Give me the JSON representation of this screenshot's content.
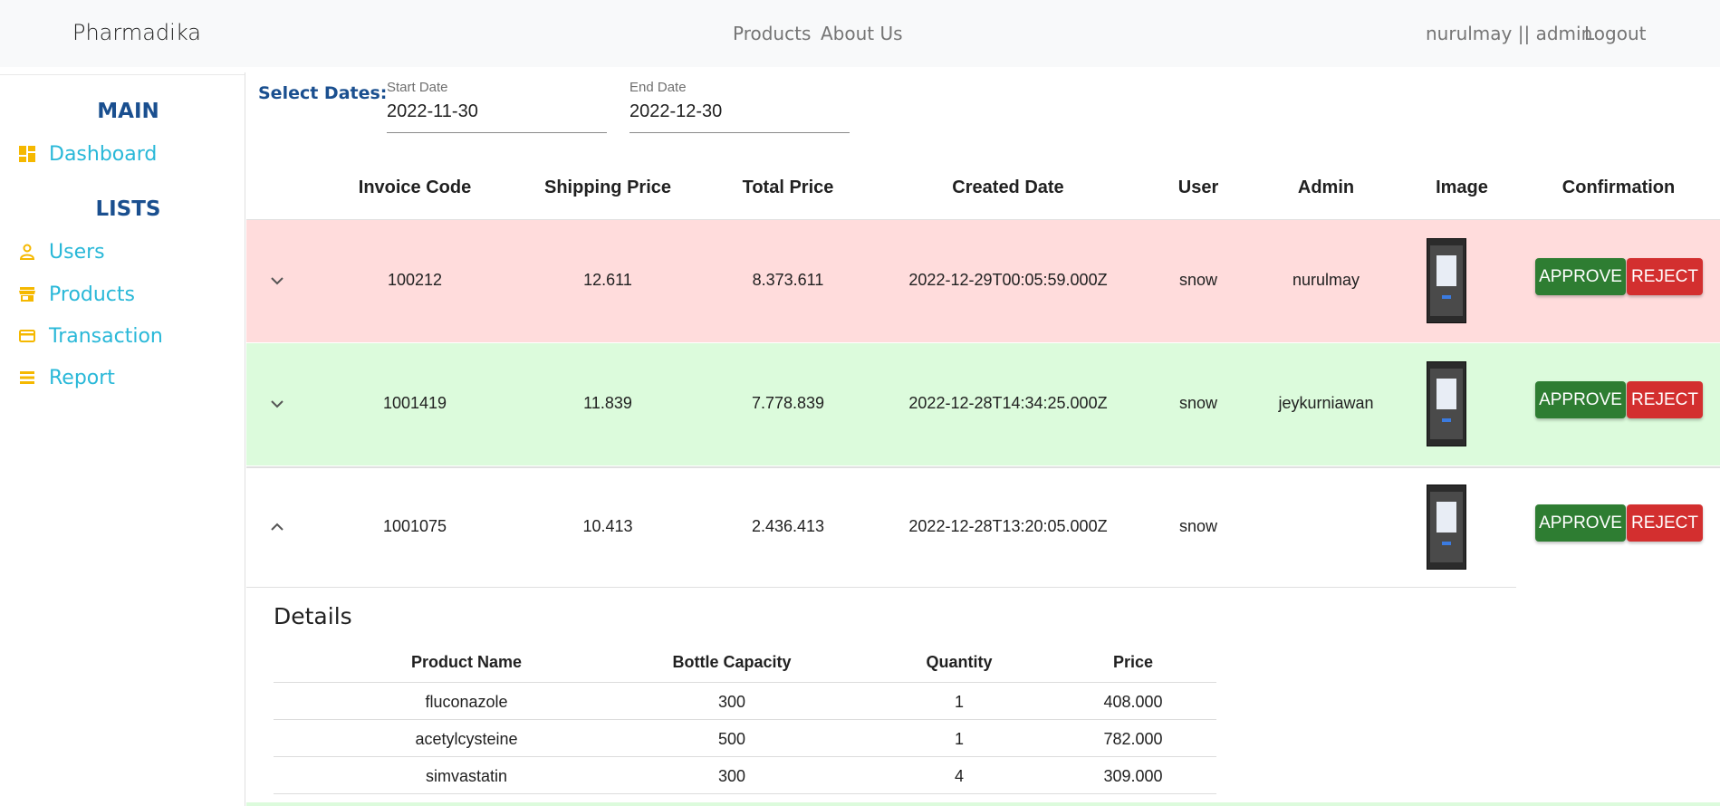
{
  "navbar": {
    "brand": "Pharmadika",
    "links": [
      "Products",
      "About Us"
    ],
    "user": "nurulmay || admin",
    "logout": "Logout"
  },
  "sidebar": {
    "main_title": "MAIN",
    "dashboard": "Dashboard",
    "lists_title": "LISTS",
    "items": [
      "Users",
      "Products",
      "Transaction",
      "Report"
    ]
  },
  "filters": {
    "select_label": "Select Dates:",
    "start_label": "Start Date",
    "start_value": "2022-11-30",
    "end_label": "End Date",
    "end_value": "2022-12-30"
  },
  "table": {
    "headers": [
      "Invoice Code",
      "Shipping Price",
      "Total Price",
      "Created Date",
      "User",
      "Admin",
      "Image",
      "Confirmation"
    ],
    "rows": [
      {
        "invoice": "100212",
        "shipping": "12.611",
        "total": "8.373.611",
        "created": "2022-12-29T00:05:59.000Z",
        "user": "snow",
        "admin": "nurulmay",
        "bg": "#ffdcdc",
        "expanded": false
      },
      {
        "invoice": "1001419",
        "shipping": "11.839",
        "total": "7.778.839",
        "created": "2022-12-28T14:34:25.000Z",
        "user": "snow",
        "admin": "jeykurniawan",
        "bg": "#dcfbdc",
        "expanded": false
      },
      {
        "invoice": "1001075",
        "shipping": "10.413",
        "total": "2.436.413",
        "created": "2022-12-28T13:20:05.000Z",
        "user": "snow",
        "admin": "",
        "bg": "#ffffff",
        "expanded": true
      }
    ],
    "approve_label": "APPROVE",
    "reject_label": "REJECT"
  },
  "details": {
    "title": "Details",
    "headers": [
      "Product Name",
      "Bottle Capacity",
      "Quantity",
      "Price"
    ],
    "rows": [
      [
        "fluconazole",
        "300",
        "1",
        "408.000"
      ],
      [
        "acetylcysteine",
        "500",
        "1",
        "782.000"
      ],
      [
        "simvastatin",
        "300",
        "4",
        "309.000"
      ]
    ]
  },
  "colors": {
    "accent": "#29b8d8",
    "section_title": "#1a4f8f",
    "icon": "#f5b800",
    "approve": "#2e7d32",
    "reject": "#d32f2f",
    "row_pending": "#ffdcdc",
    "row_ok": "#dcfbdc"
  },
  "icons": {
    "dashboard": "dashboard-icon",
    "users": "person-icon",
    "products": "store-icon",
    "transaction": "credit-card-icon",
    "report": "list-icon",
    "expand": "chevron-down-icon",
    "collapse": "chevron-up-icon"
  }
}
